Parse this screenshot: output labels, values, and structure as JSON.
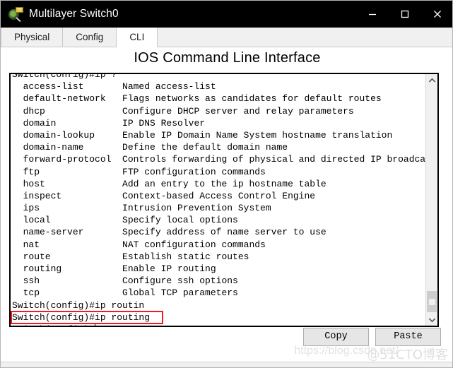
{
  "window": {
    "title": "Multilayer Switch0",
    "icon": "packet-tracer-switch-icon",
    "controls": {
      "minimize": "minimize-icon",
      "maximize": "maximize-icon",
      "close": "close-icon"
    }
  },
  "tabs": [
    {
      "label": "Physical",
      "active": false
    },
    {
      "label": "Config",
      "active": false
    },
    {
      "label": "CLI",
      "active": true
    }
  ],
  "panel": {
    "title": "IOS Command Line Interface"
  },
  "terminal": {
    "lines": [
      "Switch(config)#ip ?",
      "  access-list       Named access-list",
      "  default-network   Flags networks as candidates for default routes",
      "  dhcp              Configure DHCP server and relay parameters",
      "  domain            IP DNS Resolver",
      "  domain-lookup     Enable IP Domain Name System hostname translation",
      "  domain-name       Define the default domain name",
      "  forward-protocol  Controls forwarding of physical and directed IP broadcasts",
      "  ftp               FTP configuration commands",
      "  host              Add an entry to the ip hostname table",
      "  inspect           Context-based Access Control Engine",
      "  ips               Intrusion Prevention System",
      "  local             Specify local options",
      "  name-server       Specify address of name server to use",
      "  nat               NAT configuration commands",
      "  route             Establish static routes",
      "  routing           Enable IP routing",
      "  ssh               Configure ssh options",
      "  tcp               Global TCP parameters",
      "Switch(config)#ip routin",
      "Switch(config)#ip routing",
      "Switch(config)#"
    ],
    "highlighted_line_index": 20,
    "highlight_color": "#ee1c24",
    "prompt": "Switch(config)#",
    "cursor_line_index": 21
  },
  "scrollbar": {
    "up_arrow": "chevron-up-icon",
    "down_arrow": "chevron-down-icon",
    "thumb": "scrollbar-thumb"
  },
  "buttons": {
    "copy": "Copy",
    "paste": "Paste"
  },
  "watermark": {
    "url": "https://blog.csdn.net/",
    "brand": "@51CTO博客"
  }
}
